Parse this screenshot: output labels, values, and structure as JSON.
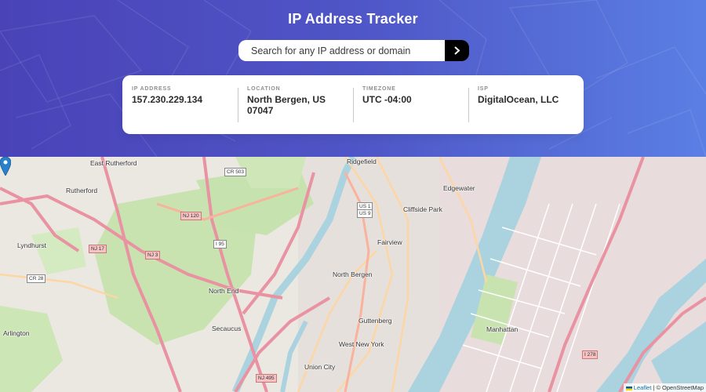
{
  "header": {
    "title": "IP Address Tracker",
    "search_placeholder": "Search for any IP address or domain",
    "search_value": "",
    "search_button_icon": "chevron-right-icon"
  },
  "info": [
    {
      "label": "IP ADDRESS",
      "value": "157.230.229.134"
    },
    {
      "label": "LOCATION",
      "value": "North Bergen, US 07047"
    },
    {
      "label": "TIMEZONE",
      "value": "UTC -04:00"
    },
    {
      "label": "ISP",
      "value": "DigitalOcean, LLC"
    }
  ],
  "map": {
    "places": [
      "East Rutherford",
      "Ridgefield",
      "Rutherford",
      "Edgewater",
      "Cliffside Park",
      "Lyndhurst",
      "Fairview",
      "North Bergen",
      "North End",
      "Guttenberg",
      "Secaucus",
      "West New York",
      "Arlington",
      "Union City",
      "Manhattan"
    ],
    "shields": [
      "CR 503",
      "NJ 120",
      "NJ 17",
      "NJ 3",
      "I 95",
      "US 1",
      "US 9",
      "CR 28",
      "I 278",
      "NJ 495"
    ],
    "attribution_leaflet": "Leaflet",
    "attribution_osm": "| © OpenStreetMap",
    "colors": {
      "water": "#aad3df",
      "park": "#c8e3b0",
      "major_road": "#e892a2",
      "secondary_road": "#fcd6a4",
      "urban": "#e4dede"
    }
  }
}
